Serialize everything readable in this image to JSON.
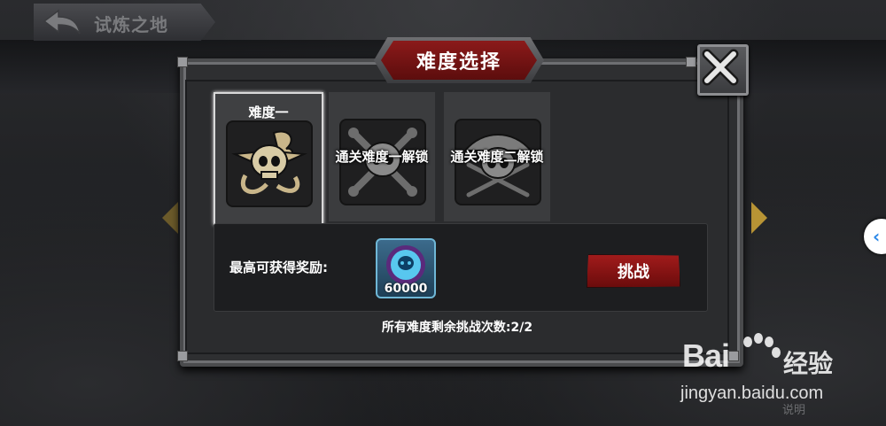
{
  "screen": {
    "title": "试炼之地"
  },
  "dialog": {
    "title": "难度选择",
    "close_icon": "close-x-icon"
  },
  "difficulties": [
    {
      "label": "难度一",
      "locked": false,
      "icon": "skull-ponytail-pipe-icon"
    },
    {
      "label": "通关难度一解锁",
      "locked": true,
      "icon": "skull-crossbones-icon"
    },
    {
      "label": "通关难度二解锁",
      "locked": true,
      "icon": "skull-pirate-hat-swords-icon"
    }
  ],
  "reward": {
    "label": "最高可获得奖励:",
    "item_icon": "blue-skull-orb-icon",
    "quantity": "60000"
  },
  "challenge_button": "挑战",
  "attempts_text": "所有难度剩余挑战次数:2/2",
  "footer": {
    "help": "说明"
  },
  "watermark": {
    "brand": "Bai",
    "brand_cn": "经验",
    "url": "jingyan.baidu.com"
  },
  "colors": {
    "accent_red": "#8b1a1a",
    "panel_bg": "#2e2f31",
    "reward_border": "#6fb7d6"
  }
}
